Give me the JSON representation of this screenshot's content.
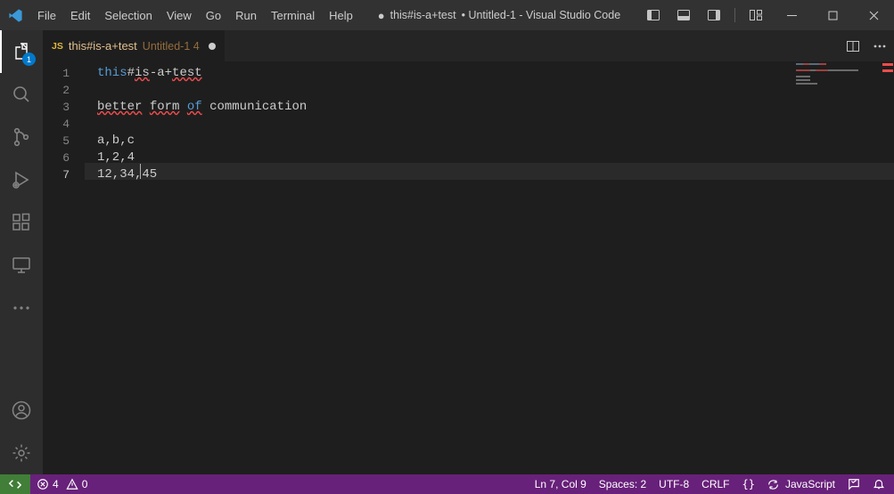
{
  "colors": {
    "accent": "#007acc",
    "statusbar": "#68217a",
    "remote": "#417e38"
  },
  "window": {
    "title_prefix": "● ",
    "doc_name": "this#is-a+test",
    "doc_suffix": " • Untitled-1 - Visual Studio Code"
  },
  "menubar": {
    "items": [
      "File",
      "Edit",
      "Selection",
      "View",
      "Go",
      "Run",
      "Terminal",
      "Help"
    ]
  },
  "activitybar": {
    "top": [
      {
        "name": "explorer-icon",
        "badge": "1",
        "active": true
      },
      {
        "name": "search-icon"
      },
      {
        "name": "source-control-icon"
      },
      {
        "name": "run-debug-icon"
      },
      {
        "name": "extensions-icon"
      },
      {
        "name": "remote-explorer-icon"
      },
      {
        "name": "more-icon"
      }
    ],
    "bottom": [
      {
        "name": "account-icon"
      },
      {
        "name": "settings-gear-icon"
      }
    ]
  },
  "tab": {
    "lang_badge": "JS",
    "filename": "this#is-a+test",
    "description": "Untitled-1 4",
    "dirty": true
  },
  "editor": {
    "lines_html": [
      "<span class='kw'>this</span><span>#</span><span class='err'>is</span><span>-a+</span><span class='err'>test</span>",
      "",
      "<span class='err'>better</span> <span class='err'>form</span> <span class='kw err'>of</span> <span>communication</span>",
      "",
      "<span>a,b,c</span>",
      "<span>1,2,4</span>",
      "<span>12,34,45</span>"
    ],
    "cursor": {
      "line": 7,
      "col": 9
    }
  },
  "statusbar": {
    "errors": "4",
    "warnings": "0",
    "position": "Ln 7, Col 9",
    "indent": "Spaces: 2",
    "encoding": "UTF-8",
    "eol": "CRLF",
    "language": "JavaScript",
    "braces": "{}"
  }
}
